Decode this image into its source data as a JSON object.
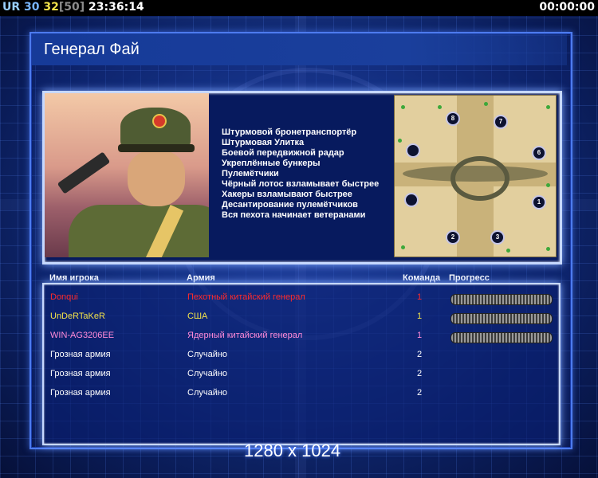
{
  "topbar": {
    "ur": "UR",
    "n30": "30",
    "n32": "32",
    "n50": "[50]",
    "clock": "23:36:14",
    "timer": "00:00:00"
  },
  "general": {
    "title": "Генерал Фай",
    "bonuses": [
      "Штурмовой бронетранспортёр",
      "Штурмовая Улитка",
      "Боевой передвижной радар",
      "Укреплённые бункеры",
      "Пулемётчики",
      "Чёрный лотос взламывает быстрее",
      "Хакеры взламывают быстрее",
      "Десантирование пулемётчиков",
      "Вся пехота начинает ветеранами"
    ]
  },
  "minimap": {
    "spawns": [
      "8",
      "7",
      "6",
      "1",
      "2",
      "3"
    ]
  },
  "table": {
    "headers": {
      "name": "Имя игрока",
      "army": "Армия",
      "team": "Команда",
      "progress": "Прогресс"
    },
    "rows": [
      {
        "name": "Donqui",
        "army": "Пехотный китайский генерал",
        "team": "1",
        "color": "#ff2a2a",
        "progress": true
      },
      {
        "name": "UnDeRTaKeR",
        "army": "США",
        "team": "1",
        "color": "#f2e24a",
        "progress": true
      },
      {
        "name": "WIN-AG3206EE",
        "army": "Ядерный китайский генерал",
        "team": "1",
        "color": "#ff8ad8",
        "progress": true
      },
      {
        "name": "Грозная армия",
        "army": "Случайно",
        "team": "2",
        "color": "#ffffff",
        "progress": false
      },
      {
        "name": "Грозная армия",
        "army": "Случайно",
        "team": "2",
        "color": "#ffffff",
        "progress": false
      },
      {
        "name": "Грозная армия",
        "army": "Случайно",
        "team": "2",
        "color": "#ffffff",
        "progress": false
      }
    ]
  },
  "resolution": "1280 x 1024"
}
